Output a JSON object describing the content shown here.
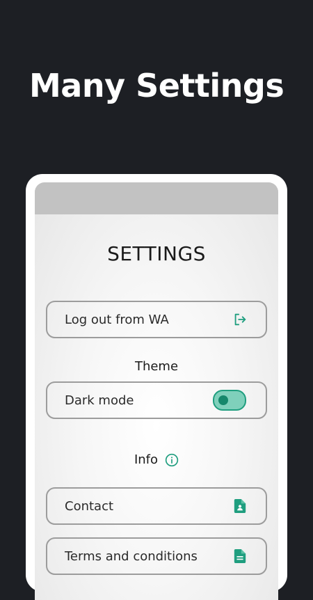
{
  "promo": {
    "title": "Many Settings"
  },
  "screen": {
    "title": "SETTINGS",
    "logout": {
      "label": "Log out from WA",
      "icon": "logout-icon"
    },
    "theme_section": {
      "heading": "Theme",
      "dark_mode_label": "Dark mode",
      "dark_mode_enabled": true
    },
    "info_section": {
      "heading": "Info",
      "icon": "info-icon"
    },
    "contact": {
      "label": "Contact",
      "icon": "contact-document-icon"
    },
    "terms": {
      "label": "Terms and conditions",
      "icon": "document-icon"
    }
  },
  "colors": {
    "background": "#1d1f24",
    "accent": "#1f9e7f",
    "toggle_fill": "#7fd0bb",
    "status_bar": "#c2c2c2"
  }
}
